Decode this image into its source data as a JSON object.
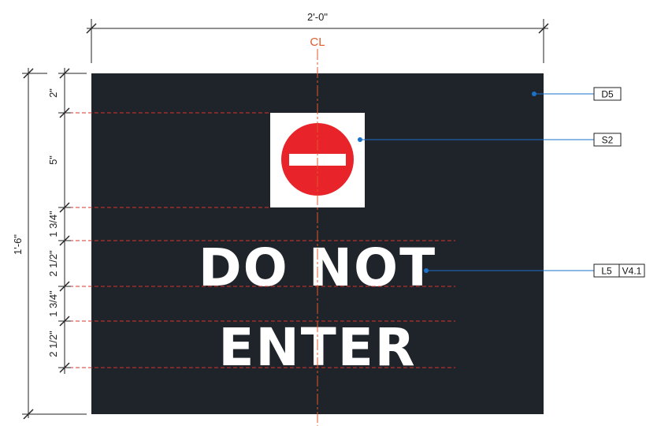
{
  "overall": {
    "width_label": "2'-0\"",
    "height_label": "1'-6\""
  },
  "centerline_label": "CL",
  "sign": {
    "line1": "DO NOT",
    "line2": "ENTER",
    "panel_color": "#1f232a",
    "symbol_color": "#e8232a",
    "text_color": "#ffffff"
  },
  "vertical_dims": [
    "2\"",
    "5\"",
    "1 3/4\"",
    "2 1/2\"",
    "1 3/4\"",
    "2 1/2\""
  ],
  "callouts": {
    "panel": "D5",
    "symbol": "S2",
    "lettering": "L5",
    "lettering_detail": "V4.1"
  },
  "colors": {
    "guide_line": "#d9332b",
    "centerline": "#e05a2b",
    "leader": "#1a72c9"
  }
}
